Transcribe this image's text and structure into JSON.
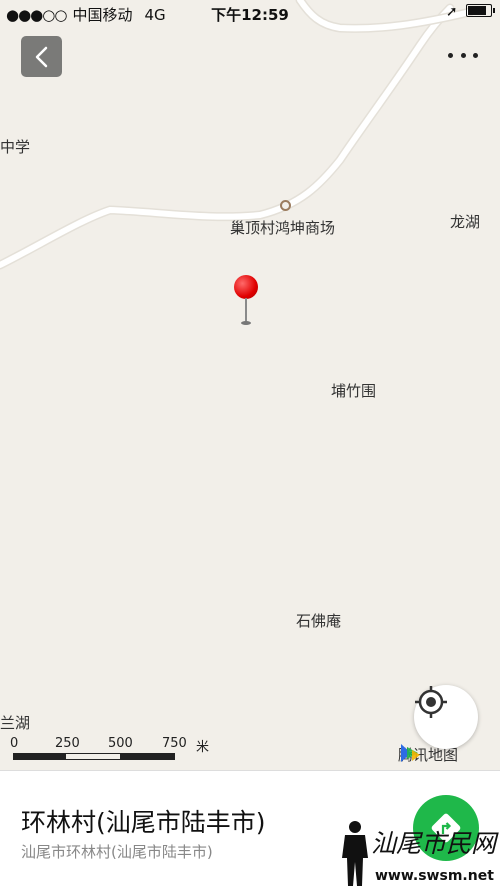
{
  "status_bar": {
    "signal": "●●●○○",
    "carrier": "中国移动",
    "network": "4G",
    "time": "下午12:59",
    "battery_level": 0.9
  },
  "header": {
    "back_icon": "chevron-left-icon",
    "more_icon": "more-dots-icon"
  },
  "map": {
    "labels": {
      "school": "中学",
      "mall": "巢顶村鸿坤商场",
      "longhu": "龙湖",
      "buzhuwei": "埔竹围",
      "shifoan": "石佛庵",
      "lanhu": "兰湖"
    },
    "scale": {
      "marks": [
        "0",
        "250",
        "500",
        "750"
      ],
      "unit": "米"
    },
    "brand": "腾讯地图"
  },
  "location": {
    "title": "环林村(汕尾市陆丰市)",
    "subtitle": "汕尾市环林村(汕尾市陆丰市)"
  },
  "watermark": {
    "text": "汕尾市民网",
    "url": "www.swsm.net"
  },
  "colors": {
    "map_bg": "#f2efe9",
    "road": "#ffffff",
    "pin": "#e00000",
    "nav_button": "#1fb84a",
    "back_button": "#7a7a78"
  }
}
